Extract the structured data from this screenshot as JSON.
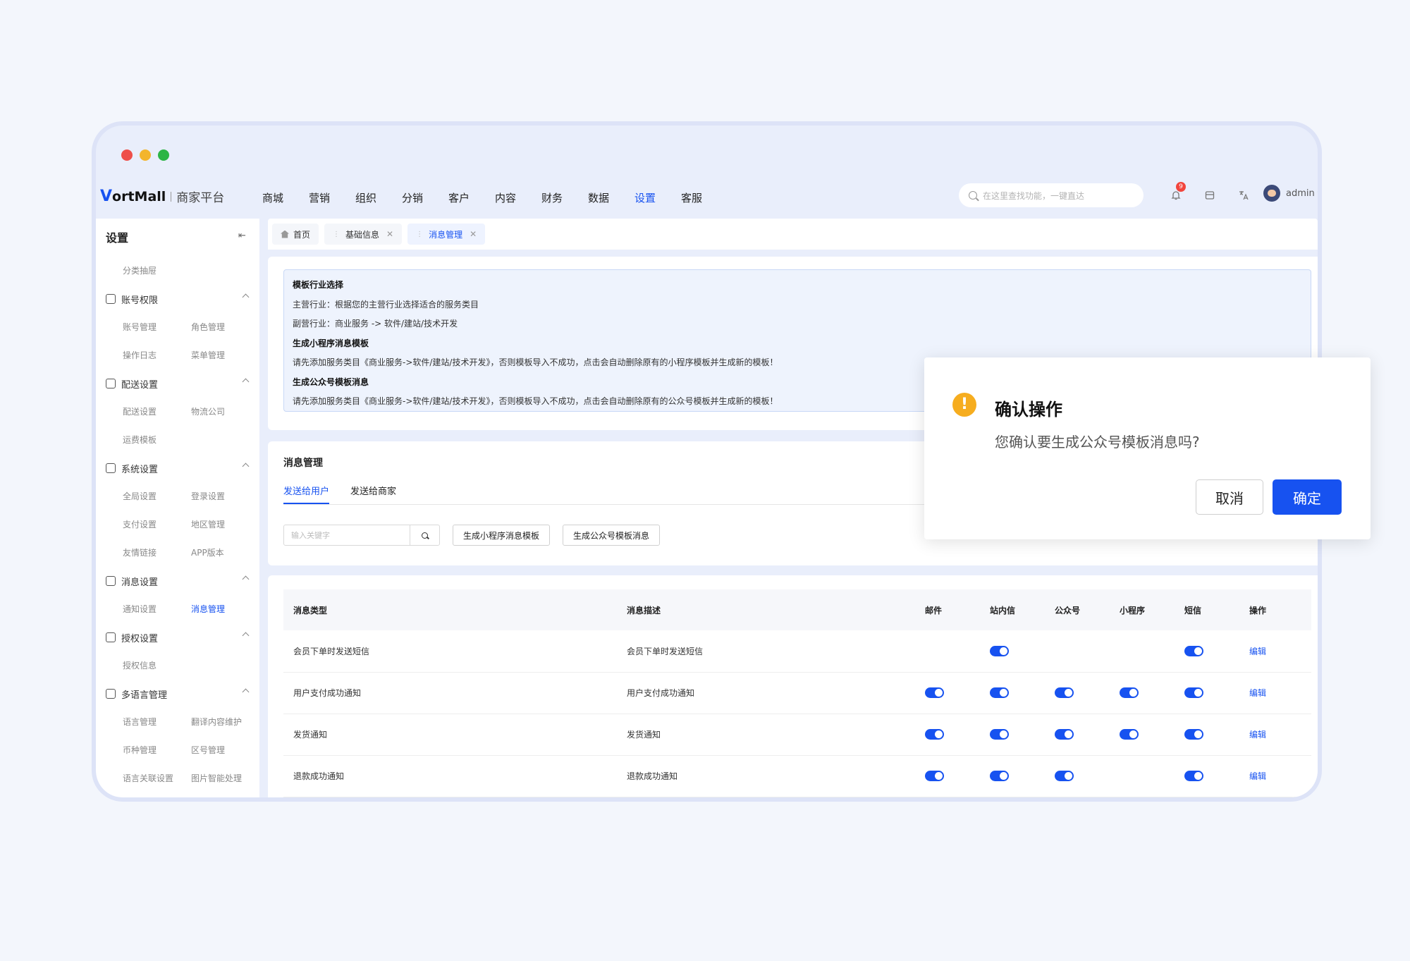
{
  "topbar": {
    "logo_mark": "V",
    "logo_word": "ortMall",
    "logo_sub": "商家平台",
    "nav": [
      "商城",
      "营销",
      "组织",
      "分销",
      "客户",
      "内容",
      "财务",
      "数据",
      "设置",
      "客服"
    ],
    "nav_active": "设置",
    "search_placeholder": "在这里查找功能，一键直达",
    "notification_count": "9",
    "user_name": "admin"
  },
  "sidebar": {
    "title": "设置",
    "top_item": "分类抽屉",
    "groups": [
      {
        "label": "账号权限",
        "icon": "user-icon",
        "items": [
          "账号管理",
          "角色管理",
          "操作日志",
          "菜单管理"
        ]
      },
      {
        "label": "配送设置",
        "icon": "truck-icon",
        "items": [
          "配送设置",
          "物流公司",
          "运费模板"
        ]
      },
      {
        "label": "系统设置",
        "icon": "gear-icon",
        "items": [
          "全局设置",
          "登录设置",
          "支付设置",
          "地区管理",
          "友情链接",
          "APP版本"
        ]
      },
      {
        "label": "消息设置",
        "icon": "message-icon",
        "items": [
          "通知设置",
          "消息管理"
        ]
      },
      {
        "label": "授权设置",
        "icon": "shield-icon",
        "items": [
          "授权信息"
        ]
      },
      {
        "label": "多语言管理",
        "icon": "translate-icon",
        "items": [
          "语言管理",
          "翻译内容维护",
          "币种管理",
          "区号管理",
          "语言关联设置",
          "图片智能处理"
        ]
      }
    ],
    "active_item": "消息管理"
  },
  "tabs": [
    {
      "label": "首页",
      "closable": false
    },
    {
      "label": "基础信息",
      "closable": true
    },
    {
      "label": "消息管理",
      "closable": true
    }
  ],
  "info": {
    "lines": [
      {
        "text": "模板行业选择",
        "bold": true
      },
      {
        "text": "主营行业：根据您的主营行业选择适合的服务类目",
        "bold": false
      },
      {
        "text": "副营行业：商业服务 -> 软件/建站/技术开发",
        "bold": false
      },
      {
        "text": "生成小程序消息模板",
        "bold": true
      },
      {
        "text": "请先添加服务类目《商业服务->软件/建站/技术开发》，否则模板导入不成功，点击会自动删除原有的小程序模板并生成新的模板！",
        "bold": false
      },
      {
        "text": "生成公众号模板消息",
        "bold": true
      },
      {
        "text": "请先添加服务类目《商业服务->软件/建站/技术开发》，否则模板导入不成功，点击会自动删除原有的公众号模板并生成新的模板！",
        "bold": false
      }
    ]
  },
  "message": {
    "title": "消息管理",
    "tabs": [
      "发送给用户",
      "发送给商家"
    ],
    "search_placeholder": "输入关键字",
    "gen_mini_label": "生成小程序消息模板",
    "gen_mp_label": "生成公众号模板消息"
  },
  "table": {
    "headers": [
      "消息类型",
      "消息描述",
      "邮件",
      "站内信",
      "公众号",
      "小程序",
      "短信",
      "操作"
    ],
    "rows": [
      {
        "type": "会员下单时发送短信",
        "desc": "会员下单时发送短信",
        "mail": false,
        "site": true,
        "mp": false,
        "mini": false,
        "sms": true,
        "action": "编辑"
      },
      {
        "type": "用户支付成功通知",
        "desc": "用户支付成功通知",
        "mail": true,
        "site": true,
        "mp": true,
        "mini": true,
        "sms": true,
        "action": "编辑"
      },
      {
        "type": "发货通知",
        "desc": "发货通知",
        "mail": true,
        "site": true,
        "mp": true,
        "mini": true,
        "sms": true,
        "action": "编辑"
      },
      {
        "type": "退款成功通知",
        "desc": "退款成功通知",
        "mail": true,
        "site": true,
        "mp": true,
        "mini": false,
        "sms": true,
        "action": "编辑"
      }
    ]
  },
  "dialog": {
    "icon": "!",
    "title": "确认操作",
    "text": "您确认要生成公众号模板消息吗?",
    "cancel": "取消",
    "ok": "确定"
  },
  "colors": {
    "accent": "#1752f0",
    "warning": "#f6ad1f",
    "badge": "#f2453d"
  }
}
